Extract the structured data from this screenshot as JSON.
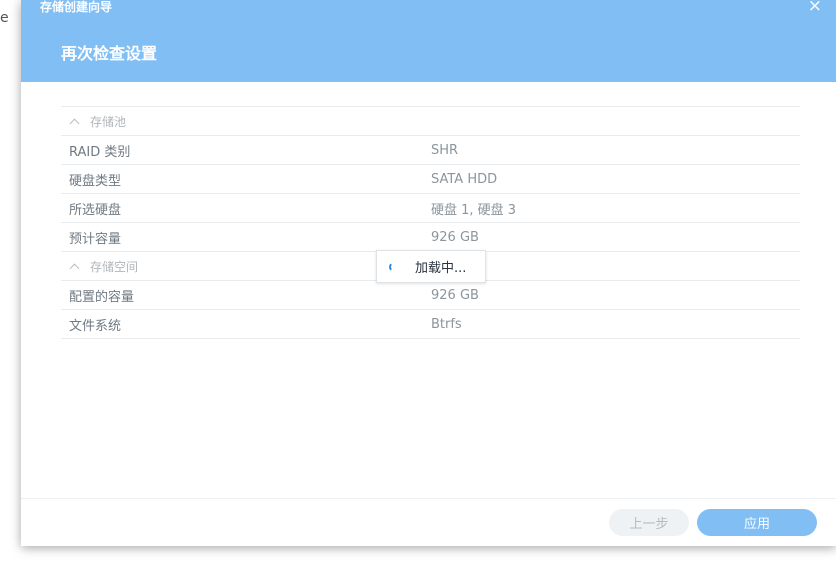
{
  "background": {
    "fragment_text": "e"
  },
  "dialog": {
    "window_title": "存储创建向导",
    "close_glyph": "×",
    "step_title": "再次检查设置"
  },
  "summary": {
    "groups": [
      {
        "title": "存储池",
        "rows": [
          {
            "label": "RAID 类别",
            "value": "SHR"
          },
          {
            "label": "硬盘类型",
            "value": "SATA HDD"
          },
          {
            "label": "所选硬盘",
            "value": "硬盘 1, 硬盘 3"
          },
          {
            "label": "预计容量",
            "value": "926 GB"
          }
        ]
      },
      {
        "title": "存储空间",
        "rows": [
          {
            "label": "配置的容量",
            "value": "926 GB"
          },
          {
            "label": "文件系统",
            "value": "Btrfs"
          }
        ]
      }
    ]
  },
  "loading": {
    "text": "加载中..."
  },
  "footer": {
    "prev_label": "上一步",
    "apply_label": "应用"
  },
  "colors": {
    "accent": "#80bef4",
    "spinner": "#2e8be0"
  }
}
